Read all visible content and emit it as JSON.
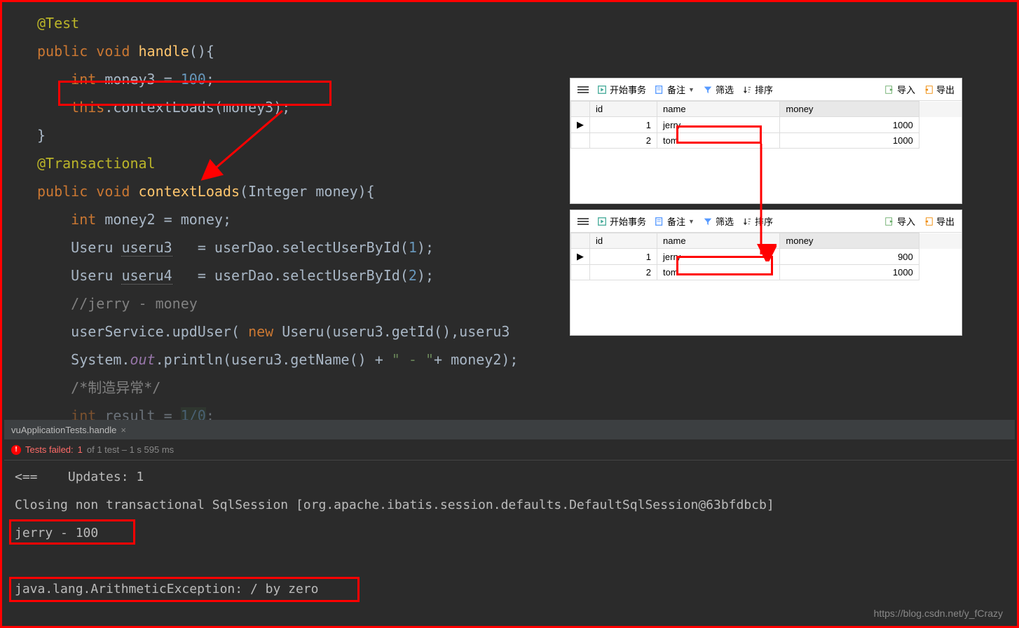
{
  "code": {
    "annotation_test": "@Test",
    "public": "public",
    "void": "void",
    "handle_method": "handle",
    "int": "int",
    "money3_var": "money3",
    "eq": " = ",
    "hundred": "100",
    "semicolon": ";",
    "this": "this",
    "dot": ".",
    "contextLoads": "contextLoads",
    "lparen": "(",
    "rparen": ")",
    "lbrace": "{",
    "rbrace": "}",
    "transactional": "@Transactional",
    "integer_type": "Integer",
    "money_param": "money",
    "money2_var": "money2",
    "useru_type": "Useru",
    "useru3_var": "useru3",
    "useru4_var": "useru4",
    "spaces2": "  ",
    "userDao": "userDao",
    "selectUserById": "selectUserById",
    "one": "1",
    "two": "2",
    "comment_jerry": "//jerry - money",
    "userService": "userService",
    "updUser": "updUser",
    "new": "new",
    "getId": "getId",
    "comma": ",",
    "system": "System",
    "out": "out",
    "println": "println",
    "getName": "getName",
    "plus": " + ",
    "str_dash": "\" - \"",
    "plus2": "+ ",
    "comment_exception": "/*制造异常*/",
    "int_result": "int",
    "result_var": "result",
    "div_expr": "1/0",
    "useru3_text": "useru3"
  },
  "tab": {
    "name": "vuApplicationTests.handle"
  },
  "test_status": {
    "failed": "Tests failed:",
    "count": "1",
    "of": " of 1 test – 1 s 595 ms"
  },
  "console": {
    "line1": "<==    Updates: 1",
    "line2": "Closing non transactional SqlSession [org.apache.ibatis.session.defaults.DefaultSqlSession@63bfdbcb]",
    "line3": "jerry - 100",
    "line4": "java.lang.ArithmeticException: / by zero"
  },
  "db": {
    "toolbar": {
      "start_tx": "开始事务",
      "remark": "备注",
      "filter": "筛选",
      "sort": "排序",
      "import": "导入",
      "export": "导出"
    },
    "headers": {
      "id": "id",
      "name": "name",
      "money": "money"
    },
    "table1": [
      {
        "id": "1",
        "name": "jerry",
        "money": "1000"
      },
      {
        "id": "2",
        "name": "tom",
        "money": "1000"
      }
    ],
    "table2": [
      {
        "id": "1",
        "name": "jerry",
        "money": "900"
      },
      {
        "id": "2",
        "name": "tom",
        "money": "1000"
      }
    ]
  },
  "watermark": "https://blog.csdn.net/y_fCrazy"
}
